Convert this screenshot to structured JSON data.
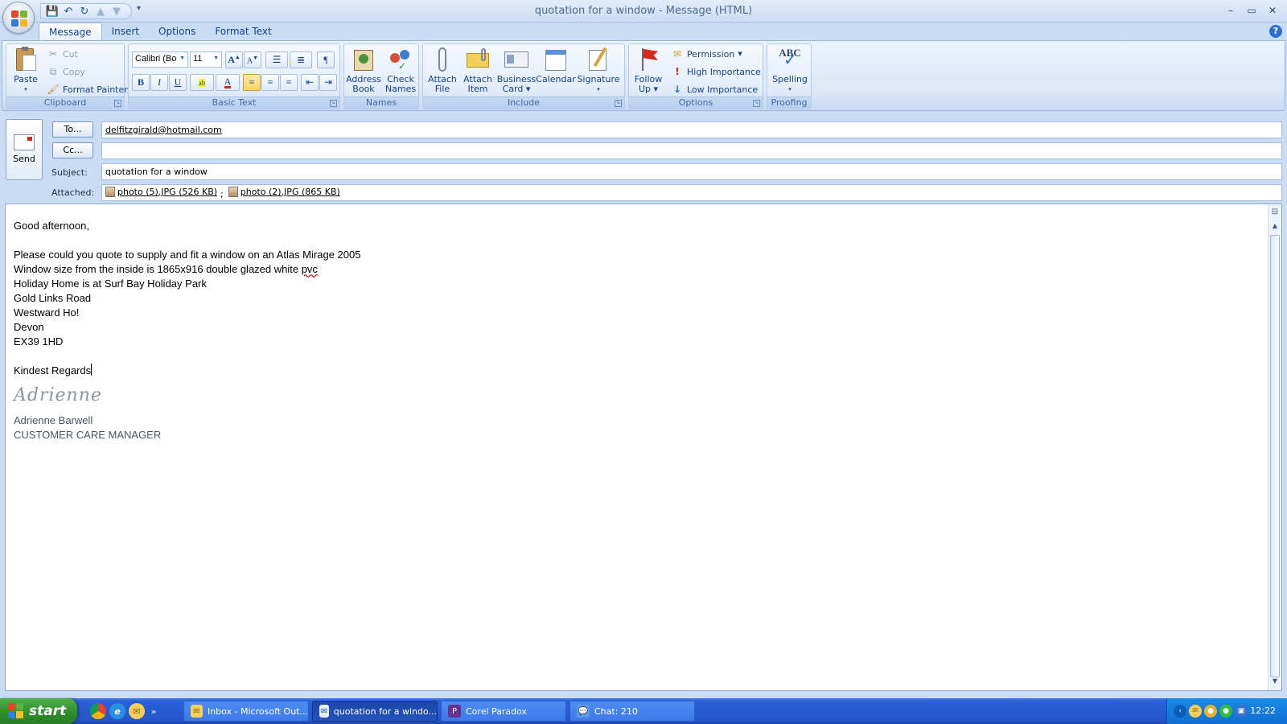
{
  "window": {
    "title": "quotation for a window - Message (HTML)",
    "controls": [
      "–",
      "▭",
      "✕"
    ]
  },
  "tabs": [
    {
      "label": "Message",
      "active": true
    },
    {
      "label": "Insert",
      "active": false
    },
    {
      "label": "Options",
      "active": false
    },
    {
      "label": "Format Text",
      "active": false
    }
  ],
  "ribbon": {
    "clipboard": {
      "label": "Clipboard",
      "paste": "Paste",
      "cut": "Cut",
      "copy": "Copy",
      "format_painter": "Format Painter"
    },
    "basic_text": {
      "label": "Basic Text",
      "font_name": "Calibri (Bo",
      "font_size": "11"
    },
    "names": {
      "label": "Names",
      "address_book": [
        "Address",
        "Book"
      ],
      "check_names": [
        "Check",
        "Names"
      ]
    },
    "include": {
      "label": "Include",
      "attach_file": [
        "Attach",
        "File"
      ],
      "attach_item": [
        "Attach",
        "Item"
      ],
      "business_card": [
        "Business",
        "Card"
      ],
      "calendar": "Calendar",
      "signature": "Signature"
    },
    "options": {
      "label": "Options",
      "follow_up": [
        "Follow",
        "Up"
      ],
      "permission": "Permission",
      "high_importance": "High Importance",
      "low_importance": "Low Importance"
    },
    "proofing": {
      "label": "Proofing",
      "spelling": "Spelling",
      "abc": "ABC"
    }
  },
  "header": {
    "send": "Send",
    "to_button": "To...",
    "cc_button": "Cc...",
    "subject_label": "Subject:",
    "attached_label": "Attached:",
    "to_value": "delfitzgirald@hotmail.com",
    "cc_value": "",
    "subject_value": "quotation for a window",
    "attachments": [
      "photo (5).JPG (526 KB)",
      "photo (2).JPG (865 KB)"
    ],
    "attachment_separator": ";"
  },
  "body": {
    "greeting": "Good afternoon,",
    "line1": "Please could you quote to supply and fit a window on an Atlas Mirage 2005",
    "line2_pre": "Window size from the inside is 1865x916 double glazed white ",
    "line2_misspelled": "pvc",
    "line3": "Holiday Home is at Surf Bay Holiday Park",
    "line4": "Gold Links Road",
    "line5": "Westward Ho!",
    "line6": "Devon",
    "line7": "EX39 1HD",
    "closing": "Kindest Regards",
    "signature_script": "Adrienne",
    "sig_name": "Adrienne Barwell",
    "sig_title": "CUSTOMER CARE MANAGER"
  },
  "taskbar": {
    "start": "start",
    "quick_more": "»",
    "tasks": [
      {
        "label": "Inbox - Microsoft Out...",
        "active": false
      },
      {
        "label": "quotation for a windo...",
        "active": true
      },
      {
        "label": "Corel Paradox",
        "active": false
      },
      {
        "label": "Chat: 210",
        "active": false
      }
    ],
    "clock": "12:22"
  },
  "colors": {
    "ribbon_text": "#15428b",
    "accent_blue": "#2457a6",
    "taskbar": "#2556cc",
    "start_green": "#2e8b2a",
    "spell_error": "#e02020"
  }
}
